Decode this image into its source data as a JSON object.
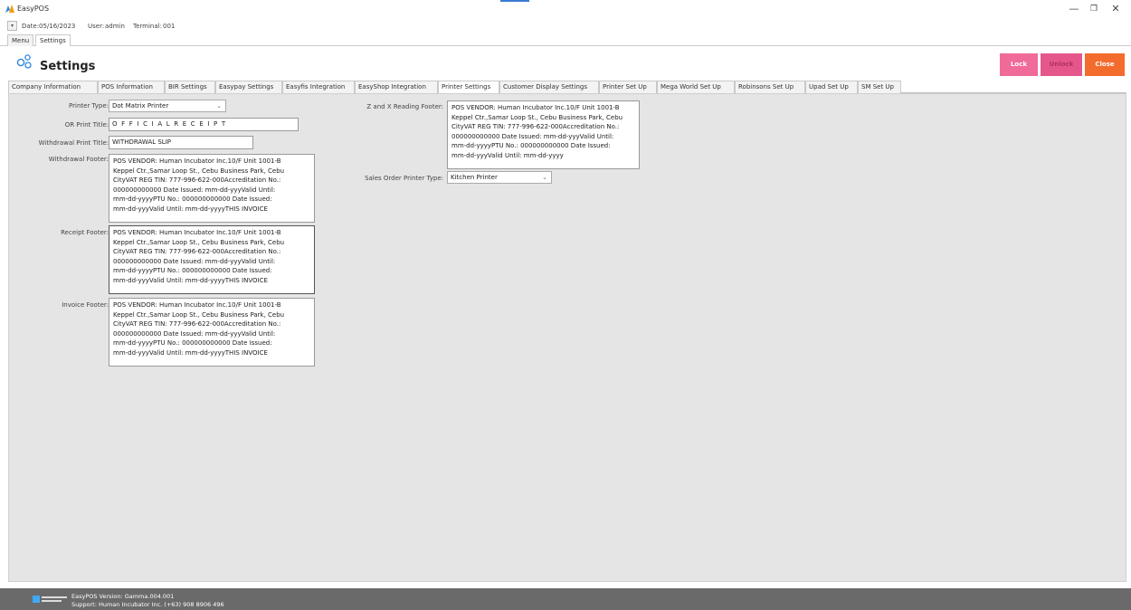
{
  "app": {
    "title": "EasyPOS"
  },
  "window": {
    "minimize": "—",
    "maximize": "❐",
    "close": "✕"
  },
  "infobar": {
    "dropdown_glyph": "▾",
    "date_label": "Date:",
    "date": "05/16/2023",
    "user_label": "User:",
    "user": "admin",
    "terminal_label": "Terminal:",
    "terminal": "001"
  },
  "form_tabs": [
    {
      "label": "Menu",
      "active": false
    },
    {
      "label": "Settings",
      "active": true
    }
  ],
  "header": {
    "title": "Settings",
    "icon": "settings-icon",
    "buttons": {
      "lock": "Lock",
      "unlock": "Unlock",
      "close": "Close"
    }
  },
  "colors": {
    "lock": "#f06a9a",
    "unlock": "#e5578b",
    "close": "#f36b2d",
    "content_bg": "#e5e5e5",
    "status_bar": "#6a6a6a"
  },
  "setting_tabs": [
    {
      "label": "Company Information",
      "active": false
    },
    {
      "label": "POS Information",
      "active": false
    },
    {
      "label": "BIR Settings",
      "active": false
    },
    {
      "label": "Easypay Settings",
      "active": false
    },
    {
      "label": "Easyfis Integration",
      "active": false
    },
    {
      "label": "EasyShop Integration",
      "active": false
    },
    {
      "label": "Printer Settings",
      "active": true
    },
    {
      "label": "Customer Display Settings",
      "active": false
    },
    {
      "label": "Printer Set Up",
      "active": false
    },
    {
      "label": "Mega World Set Up",
      "active": false
    },
    {
      "label": "Robinsons Set Up",
      "active": false
    },
    {
      "label": "Upad Set Up",
      "active": false
    },
    {
      "label": "SM Set Up",
      "active": false
    }
  ],
  "form": {
    "printer_type": {
      "label": "Printer Type:",
      "value": "Dot Matrix Printer",
      "chevron": "⌄"
    },
    "or_print_title": {
      "label": "OR Print Title:",
      "value": "O F F I C I A L  R E C E I P T"
    },
    "withdrawal_print_title": {
      "label": "Withdrawal Print Title:",
      "value": "WITHDRAWAL SLIP"
    },
    "withdrawal_footer": {
      "label": "Withdrawal Footer:",
      "lines": [
        "POS VENDOR: Human Incubator Inc.10/F Unit 1001-B",
        "Keppel Ctr.,Samar Loop St., Cebu Business Park, Cebu",
        "CityVAT REG TIN: 777-996-622-000Accreditation No.:",
        "000000000000 Date Issued: mm-dd-yyyValid Until:",
        "mm-dd-yyyyPTU No.: 000000000000 Date Issued:",
        "mm-dd-yyyValid Until: mm-dd-yyyyTHIS INVOICE"
      ]
    },
    "receipt_footer": {
      "label": "Receipt Footer:",
      "lines": [
        "POS VENDOR: Human Incubator Inc.10/F Unit 1001-B",
        "Keppel Ctr.,Samar Loop St., Cebu Business Park, Cebu",
        "CityVAT REG TIN: 777-996-622-000Accreditation No.:",
        "000000000000 Date Issued: mm-dd-yyyValid Until:",
        "mm-dd-yyyyPTU No.: 000000000000 Date Issued:",
        "mm-dd-yyyValid Until: mm-dd-yyyyTHIS INVOICE"
      ]
    },
    "invoice_footer": {
      "label": "Invoice Footer:",
      "lines": [
        "POS VENDOR: Human Incubator Inc.10/F Unit 1001-B",
        "Keppel Ctr.,Samar Loop St., Cebu Business Park, Cebu",
        "CityVAT REG TIN: 777-996-622-000Accreditation No.:",
        "000000000000 Date Issued: mm-dd-yyyValid Until:",
        "mm-dd-yyyyPTU No.: 000000000000 Date Issued:",
        "mm-dd-yyyValid Until: mm-dd-yyyyTHIS INVOICE"
      ]
    },
    "z_and_x_reading_footer": {
      "label": "Z and X Reading Footer:",
      "lines": [
        "POS VENDOR: Human Incubator Inc.10/F Unit 1001-B",
        "Keppel Ctr.,Samar Loop St., Cebu Business Park, Cebu",
        "CityVAT REG TIN: 777-996-622-000Accreditation No.:",
        "000000000000 Date Issued: mm-dd-yyyValid Until:",
        "mm-dd-yyyyPTU No.: 000000000000 Date Issued:",
        "mm-dd-yyyValid Until: mm-dd-yyyy"
      ]
    },
    "sales_order_printer_type": {
      "label": "Sales Order Printer Type:",
      "value": "Kitchen Printer",
      "chevron": "⌄"
    }
  },
  "status": {
    "version_line": "EasyPOS Version: Gamma.004.001",
    "support_line": "Support: Human Incubator Inc. (+63) 908 8906 496"
  }
}
